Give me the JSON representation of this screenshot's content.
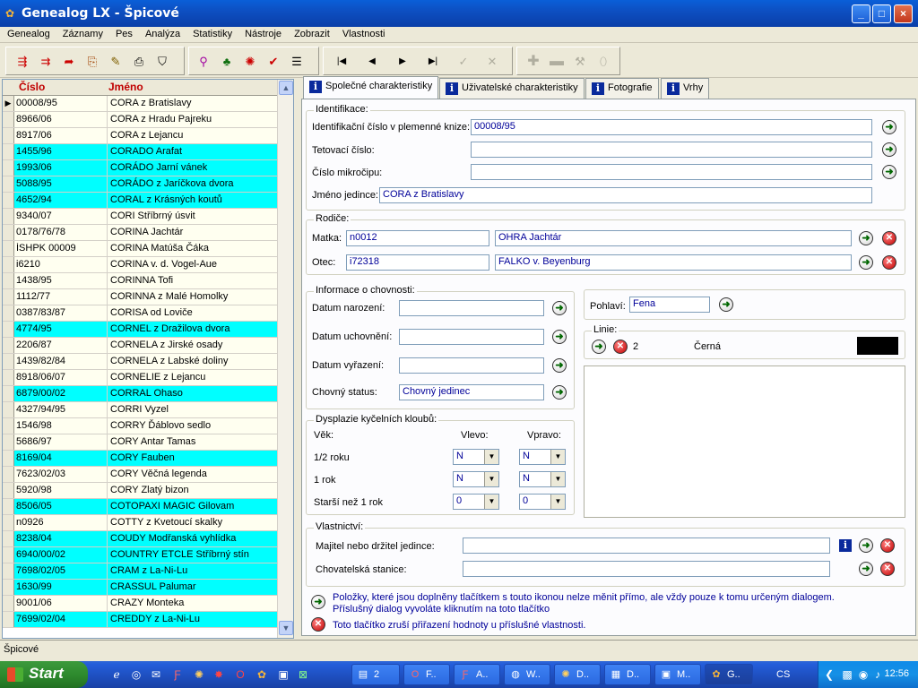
{
  "window": {
    "title": "Genealog LX - Špicové"
  },
  "menu": [
    "Genealog",
    "Záznamy",
    "Pes",
    "Analýza",
    "Statistiky",
    "Nástroje",
    "Zobrazit",
    "Vlastnosti"
  ],
  "list": {
    "col_number": "Číslo",
    "col_name": "Jméno",
    "rows": [
      {
        "n": "00008/95",
        "name": "CORA z Bratislavy",
        "hl": false,
        "cur": true
      },
      {
        "n": "8966/06",
        "name": "CORA z Hradu Pajreku",
        "hl": false
      },
      {
        "n": "8917/06",
        "name": "CORA z Lejancu",
        "hl": false
      },
      {
        "n": "1455/96",
        "name": "CORADO Arafat",
        "hl": true
      },
      {
        "n": "1993/06",
        "name": "CORÁDO Jarní vánek",
        "hl": true
      },
      {
        "n": "5088/95",
        "name": "CORÁDO z Jaríčkova dvora",
        "hl": true
      },
      {
        "n": "4652/94",
        "name": "CORAL z Krásných koutů",
        "hl": true
      },
      {
        "n": "9340/07",
        "name": "CORI Stříbrný úsvit",
        "hl": false
      },
      {
        "n": "0178/76/78",
        "name": "CORINA Jachtár",
        "hl": false
      },
      {
        "n": "ÍSHPK 00009",
        "name": "CORINA Matúša Čáka",
        "hl": false
      },
      {
        "n": "i6210",
        "name": "CORINA v. d. Vogel-Aue",
        "hl": false
      },
      {
        "n": "1438/95",
        "name": "CORINNA Tofi",
        "hl": false
      },
      {
        "n": "1112/77",
        "name": "CORINNA z Malé Homolky",
        "hl": false
      },
      {
        "n": "0387/83/87",
        "name": "CORISA od Loviče",
        "hl": false
      },
      {
        "n": "4774/95",
        "name": "CORNEL z Dražilova dvora",
        "hl": true
      },
      {
        "n": "2206/87",
        "name": "CORNELA z Jirské osady",
        "hl": false
      },
      {
        "n": "1439/82/84",
        "name": "CORNELA z Labské doliny",
        "hl": false
      },
      {
        "n": "8918/06/07",
        "name": "CORNELIE z Lejancu",
        "hl": false
      },
      {
        "n": "6879/00/02",
        "name": "CORRAL Ohaso",
        "hl": true
      },
      {
        "n": "4327/94/95",
        "name": "CORRI Vyzel",
        "hl": false
      },
      {
        "n": "1546/98",
        "name": "CORRY Ďáblovo sedlo",
        "hl": false
      },
      {
        "n": "5686/97",
        "name": "CORY Antar Tamas",
        "hl": false
      },
      {
        "n": "8169/04",
        "name": "CORY Fauben",
        "hl": true
      },
      {
        "n": "7623/02/03",
        "name": "CORY Věčná legenda",
        "hl": false
      },
      {
        "n": "5920/98",
        "name": "CORY Zlatý bizon",
        "hl": false
      },
      {
        "n": "8506/05",
        "name": "COTOPAXI MAGIC Gilovam",
        "hl": true
      },
      {
        "n": "n0926",
        "name": "COTTY z Kvetoucí skalky",
        "hl": false
      },
      {
        "n": "8238/04",
        "name": "COUDY Modřanská vyhlídka",
        "hl": true
      },
      {
        "n": "6940/00/02",
        "name": "COUNTRY ETCLE Stříbrný stín",
        "hl": true
      },
      {
        "n": "7698/02/05",
        "name": "CRAM z La-Ni-Lu",
        "hl": true
      },
      {
        "n": "1630/99",
        "name": "CRASSUL Palumar",
        "hl": true
      },
      {
        "n": "9001/06",
        "name": "CRAZY Monteka",
        "hl": false
      },
      {
        "n": "7699/02/04",
        "name": "CREDDY z La-Ni-Lu",
        "hl": true
      }
    ]
  },
  "status": "Špicové",
  "tabs": [
    "Společné charakteristiky",
    "Uživatelské charakteristiky",
    "Fotografie",
    "Vrhy"
  ],
  "ident": {
    "legend": "Identifikace:",
    "reg_label": "Identifikační číslo v plemenné knize:",
    "reg_value": "00008/95",
    "tattoo_label": "Tetovací číslo:",
    "tattoo_value": "",
    "chip_label": "Číslo mikročipu:",
    "chip_value": "",
    "name_label": "Jméno jedince:",
    "name_value": "CORA z Bratislavy"
  },
  "parents": {
    "legend": "Rodiče:",
    "dam_label": "Matka:",
    "dam_id": "n0012",
    "dam_name": "OHRA Jachtár",
    "sire_label": "Otec:",
    "sire_id": "i72318",
    "sire_name": "FALKO v. Beyenburg"
  },
  "breeding": {
    "legend": "Informace o chovnosti:",
    "born_label": "Datum narození:",
    "kept_label": "Datum uchovnění:",
    "removed_label": "Datum vyřazení:",
    "status_label": "Chovný status:",
    "status_value": "Chovný jedinec"
  },
  "sex": {
    "label": "Pohlaví:",
    "value": "Fena"
  },
  "line": {
    "legend": "Linie:",
    "number": "2",
    "color_name": "Černá",
    "color": "#000000"
  },
  "hips": {
    "legend": "Dysplazie kyčelních kloubů:",
    "age_label": "Věk:",
    "left_label": "Vlevo:",
    "right_label": "Vpravo:",
    "rows": [
      {
        "age": "1/2 roku",
        "left": "N",
        "right": "N"
      },
      {
        "age": "1 rok",
        "left": "N",
        "right": "N"
      },
      {
        "age": "Starší než 1 rok",
        "left": "0",
        "right": "0"
      }
    ]
  },
  "owner": {
    "legend": "Vlastnictví:",
    "owner_label": "Majitel nebo držitel jedince:",
    "owner_value": "",
    "kennel_label": "Chovatelská stanice:",
    "kennel_value": ""
  },
  "notes": {
    "green_line1": "Položky, které jsou doplněny tlačítkem s touto ikonou nelze měnit přímo, ale vždy pouze k tomu určeným dialogem.",
    "green_line2": "Příslušný dialog vyvoláte kliknutím na toto tlačítko",
    "red": "Toto tlačítko zruší přiřazení hodnoty u příslušné vlastnosti."
  },
  "taskbar": {
    "start": "Start",
    "tasks": [
      {
        "label": "2",
        "icon": "folder-icon"
      },
      {
        "label": "F..",
        "icon": "opera-icon"
      },
      {
        "label": "A..",
        "icon": "filezilla-icon"
      },
      {
        "label": "W..",
        "icon": "globe-icon"
      },
      {
        "label": "D..",
        "icon": "sun-icon"
      },
      {
        "label": "D..",
        "icon": "document-icon"
      },
      {
        "label": "M..",
        "icon": "window-icon"
      },
      {
        "label": "G..",
        "icon": "genealog-icon"
      }
    ],
    "lang": "CS",
    "time": "12:56"
  }
}
